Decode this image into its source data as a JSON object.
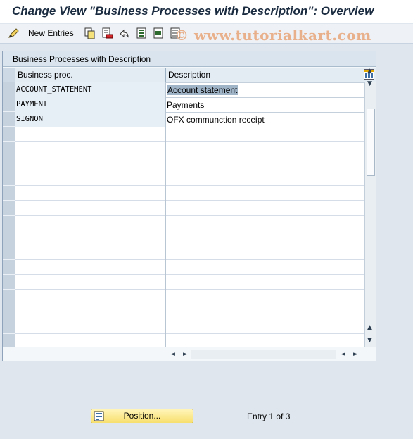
{
  "window": {
    "title": "Change View \"Business Processes with Description\": Overview"
  },
  "toolbar": {
    "new_entries_label": "New Entries",
    "icons": [
      "edit-pencil-icon",
      "copy-icon",
      "delete-icon",
      "undo-icon",
      "select-all-icon",
      "select-block-icon",
      "deselect-all-icon"
    ]
  },
  "watermark": "© www.tutorialkart.com",
  "table": {
    "caption": "Business Processes with Description",
    "columns": [
      "Business proc.",
      "Description"
    ],
    "rows": [
      {
        "key": "ACCOUNT_STATEMENT",
        "desc": "Account statement",
        "selected": true
      },
      {
        "key": "PAYMENT",
        "desc": "Payments"
      },
      {
        "key": "SIGNON",
        "desc": "OFX communction receipt"
      }
    ],
    "empty_rows": 15
  },
  "footer": {
    "position_label": "Position...",
    "entry_text": "Entry 1 of 3"
  },
  "colors": {
    "title_text": "#1a2b40",
    "button_yellow": "#f7df6e",
    "selection": "#a0b4c8",
    "watermark": "#e9b08c"
  }
}
